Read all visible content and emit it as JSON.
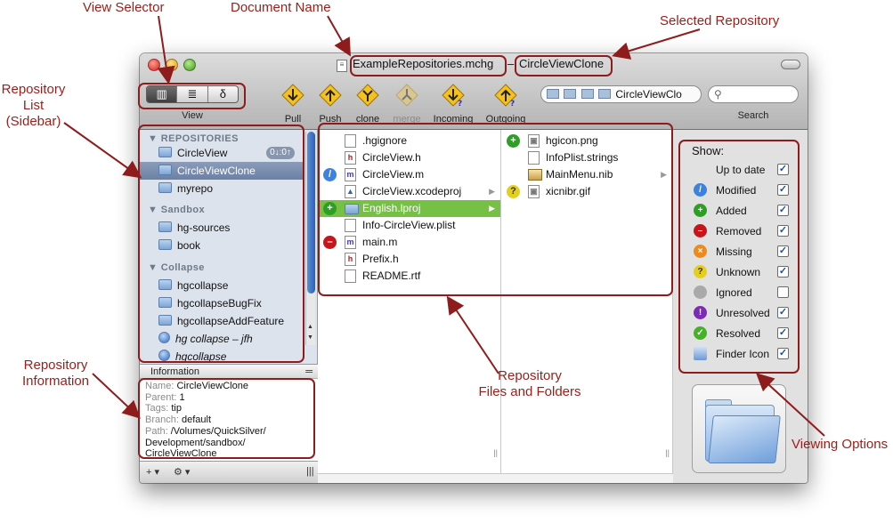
{
  "annotations": {
    "view_selector": "View Selector",
    "document_name": "Document Name",
    "selected_repository": "Selected Repository",
    "repository_list": [
      "Repository",
      "List",
      "(Sidebar)"
    ],
    "repository_information": [
      "Repository",
      "Information"
    ],
    "repository_files": [
      "Repository",
      "Files and Folders"
    ],
    "viewing_options": "Viewing Options"
  },
  "window": {
    "doc_name": "ExampleRepositories.mchg",
    "separator": "–",
    "repo_name": "CircleViewClone",
    "doc_icon": "document-icon"
  },
  "toolbar": {
    "view_segments": [
      "▥",
      "≣",
      "δ"
    ],
    "view_label": "View",
    "buttons": [
      {
        "label": "Pull",
        "icon": "pull-icon"
      },
      {
        "label": "Push",
        "icon": "push-icon"
      },
      {
        "label": "clone",
        "icon": "clone-icon"
      },
      {
        "label": "merge",
        "icon": "merge-icon"
      },
      {
        "label": "Incoming",
        "icon": "incoming-icon"
      },
      {
        "label": "Outgoing",
        "icon": "outgoing-icon"
      }
    ],
    "path_text": "CircleViewClo",
    "search_label": "Search"
  },
  "sidebar": {
    "groups": [
      "REPOSITORIES",
      "Sandbox",
      "Collapse"
    ],
    "items": [
      {
        "label": "CircleView",
        "badge": "0↓:0↑"
      },
      {
        "label": "CircleViewClone"
      },
      {
        "label": "myrepo"
      },
      {
        "label": "hg-sources"
      },
      {
        "label": "book"
      },
      {
        "label": "hgcollapse"
      },
      {
        "label": "hgcollapseBugFix"
      },
      {
        "label": "hgcollapseAddFeature"
      },
      {
        "label": "hg collapse – jfh"
      },
      {
        "label": "hgcollapse"
      }
    ]
  },
  "info": {
    "header": "Information",
    "lines": [
      {
        "k": "Name:",
        "v": "CircleViewClone"
      },
      {
        "k": "Parent:",
        "v": "1"
      },
      {
        "k": "Tags:",
        "v": "tip"
      },
      {
        "k": "Branch:",
        "v": "default"
      },
      {
        "k": "Path:",
        "v": "/Volumes/QuickSilver/"
      },
      {
        "k": "",
        "v": "Development/sandbox/"
      },
      {
        "k": "",
        "v": "CircleViewClone"
      }
    ]
  },
  "bottom": {
    "add": "+ ▾",
    "gear": "⚙ ▾",
    "resize": "|||"
  },
  "files": {
    "col1": [
      {
        "name": ".hgignore",
        "status": "",
        "type": "doc"
      },
      {
        "name": "CircleView.h",
        "status": "",
        "type": "h"
      },
      {
        "name": "CircleView.m",
        "status": "modified",
        "type": "m"
      },
      {
        "name": "CircleView.xcodeproj",
        "status": "",
        "type": "proj",
        "arrow": "▶"
      },
      {
        "name": "English.lproj",
        "status": "added",
        "type": "folder",
        "arrow": "▶"
      },
      {
        "name": "Info-CircleView.plist",
        "status": "",
        "type": "doc"
      },
      {
        "name": "main.m",
        "status": "removed",
        "type": "m"
      },
      {
        "name": "Prefix.h",
        "status": "",
        "type": "h"
      },
      {
        "name": "README.rtf",
        "status": "",
        "type": "doc"
      }
    ],
    "col2": [
      {
        "name": "hgicon.png",
        "status": "added",
        "type": "img"
      },
      {
        "name": "InfoPlist.strings",
        "status": "",
        "type": "doc"
      },
      {
        "name": "MainMenu.nib",
        "status": "",
        "type": "nib",
        "arrow": "▶"
      },
      {
        "name": "xicnibr.gif",
        "status": "unknown",
        "type": "img"
      }
    ]
  },
  "options": {
    "title": "Show:",
    "items": [
      {
        "label": "Up to date",
        "checked": true,
        "color": ""
      },
      {
        "label": "Modified",
        "checked": true,
        "color": "#3d82de"
      },
      {
        "label": "Added",
        "checked": true,
        "color": "#2f9e25"
      },
      {
        "label": "Removed",
        "checked": true,
        "color": "#c8151b"
      },
      {
        "label": "Missing",
        "checked": true,
        "color": "#ec8a1f"
      },
      {
        "label": "Unknown",
        "checked": true,
        "color": "#e6cf1b"
      },
      {
        "label": "Ignored",
        "checked": false,
        "color": "#a9a9a9"
      },
      {
        "label": "Unresolved",
        "checked": true,
        "color": "#7b2bb7"
      },
      {
        "label": "Resolved",
        "checked": true,
        "color": "#46b128"
      },
      {
        "label": "Finder Icon",
        "checked": true,
        "color": ""
      }
    ]
  }
}
